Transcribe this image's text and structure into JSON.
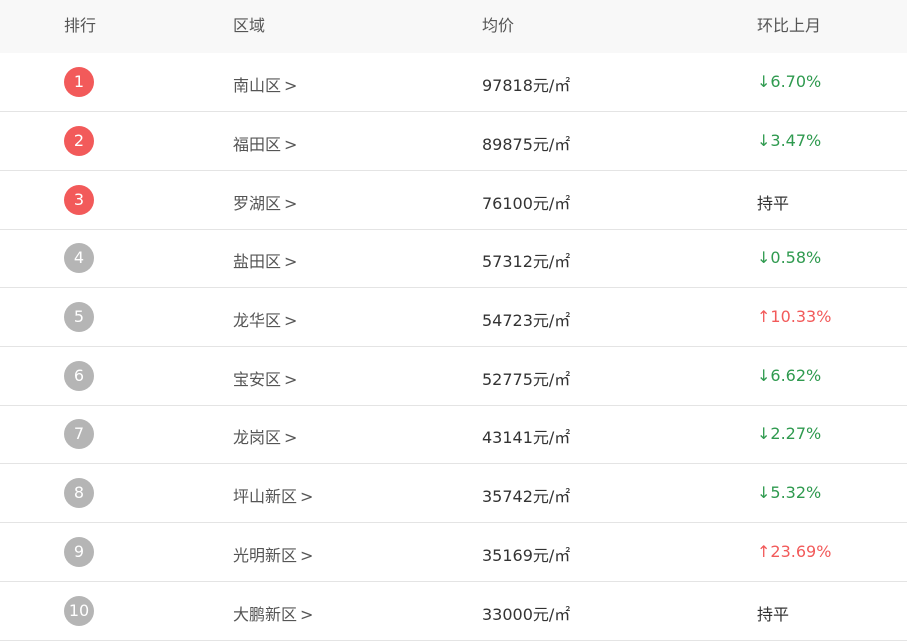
{
  "header": {
    "rank": "排行",
    "region": "区域",
    "price": "均价",
    "change": "环比上月"
  },
  "colors": {
    "top_rank": "#f25a5a",
    "other_rank": "#b5b5b5",
    "down": "#2f9a4f",
    "up": "#f25a5a"
  },
  "rows": [
    {
      "rank": "1",
      "region": "南山区",
      "link_arrow": ">",
      "price": "97818元/㎡",
      "change": "↓6.70%",
      "trend": "down"
    },
    {
      "rank": "2",
      "region": "福田区",
      "link_arrow": ">",
      "price": "89875元/㎡",
      "change": "↓3.47%",
      "trend": "down"
    },
    {
      "rank": "3",
      "region": "罗湖区",
      "link_arrow": ">",
      "price": "76100元/㎡",
      "change": "持平",
      "trend": "flat"
    },
    {
      "rank": "4",
      "region": "盐田区",
      "link_arrow": ">",
      "price": "57312元/㎡",
      "change": "↓0.58%",
      "trend": "down"
    },
    {
      "rank": "5",
      "region": "龙华区",
      "link_arrow": ">",
      "price": "54723元/㎡",
      "change": "↑10.33%",
      "trend": "up"
    },
    {
      "rank": "6",
      "region": "宝安区",
      "link_arrow": ">",
      "price": "52775元/㎡",
      "change": "↓6.62%",
      "trend": "down"
    },
    {
      "rank": "7",
      "region": "龙岗区",
      "link_arrow": ">",
      "price": "43141元/㎡",
      "change": "↓2.27%",
      "trend": "down"
    },
    {
      "rank": "8",
      "region": "坪山新区",
      "link_arrow": ">",
      "price": "35742元/㎡",
      "change": "↓5.32%",
      "trend": "down"
    },
    {
      "rank": "9",
      "region": "光明新区",
      "link_arrow": ">",
      "price": "35169元/㎡",
      "change": "↑23.69%",
      "trend": "up"
    },
    {
      "rank": "10",
      "region": "大鹏新区",
      "link_arrow": ">",
      "price": "33000元/㎡",
      "change": "持平",
      "trend": "flat"
    }
  ]
}
